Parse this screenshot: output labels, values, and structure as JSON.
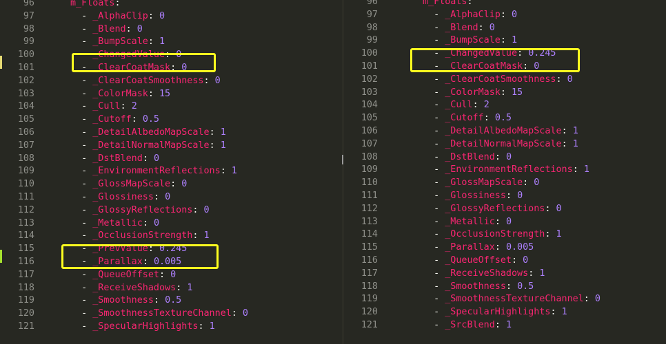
{
  "left": {
    "lines": [
      {
        "num": "96",
        "key": "m_Floats",
        "val": "",
        "indent": "",
        "dash": false
      },
      {
        "num": "97",
        "key": "_AlphaClip",
        "val": "0",
        "dash": true
      },
      {
        "num": "98",
        "key": "_Blend",
        "val": "0",
        "dash": true
      },
      {
        "num": "99",
        "key": "_BumpScale",
        "val": "1",
        "dash": true
      },
      {
        "num": "100",
        "key": "_ChangedValue",
        "val": "0",
        "dash": true
      },
      {
        "num": "101",
        "key": "_ClearCoatMask",
        "val": "0",
        "dash": true
      },
      {
        "num": "102",
        "key": "_ClearCoatSmoothness",
        "val": "0",
        "dash": true
      },
      {
        "num": "103",
        "key": "_ColorMask",
        "val": "15",
        "dash": true
      },
      {
        "num": "104",
        "key": "_Cull",
        "val": "2",
        "dash": true
      },
      {
        "num": "105",
        "key": "_Cutoff",
        "val": "0.5",
        "dash": true
      },
      {
        "num": "106",
        "key": "_DetailAlbedoMapScale",
        "val": "1",
        "dash": true
      },
      {
        "num": "107",
        "key": "_DetailNormalMapScale",
        "val": "1",
        "dash": true
      },
      {
        "num": "108",
        "key": "_DstBlend",
        "val": "0",
        "dash": true
      },
      {
        "num": "109",
        "key": "_EnvironmentReflections",
        "val": "1",
        "dash": true
      },
      {
        "num": "110",
        "key": "_GlossMapScale",
        "val": "0",
        "dash": true
      },
      {
        "num": "111",
        "key": "_Glossiness",
        "val": "0",
        "dash": true
      },
      {
        "num": "112",
        "key": "_GlossyReflections",
        "val": "0",
        "dash": true
      },
      {
        "num": "113",
        "key": "_Metallic",
        "val": "0",
        "dash": true
      },
      {
        "num": "114",
        "key": "_OcclusionStrength",
        "val": "1",
        "dash": true
      },
      {
        "num": "115",
        "key": "_PrevValue",
        "val": "0.245",
        "dash": true
      },
      {
        "num": "116",
        "key": "_Parallax",
        "val": "0.005",
        "dash": true
      },
      {
        "num": "117",
        "key": "_QueueOffset",
        "val": "0",
        "dash": true
      },
      {
        "num": "118",
        "key": "_ReceiveShadows",
        "val": "1",
        "dash": true
      },
      {
        "num": "119",
        "key": "_Smoothness",
        "val": "0.5",
        "dash": true
      },
      {
        "num": "120",
        "key": "_SmoothnessTextureChannel",
        "val": "0",
        "dash": true
      },
      {
        "num": "121",
        "key": "_SpecularHighlights",
        "val": "1",
        "dash": true
      }
    ]
  },
  "right": {
    "lines": [
      {
        "num": "96",
        "key": "m_Floats",
        "val": "",
        "dash": false
      },
      {
        "num": "97",
        "key": "_AlphaClip",
        "val": "0",
        "dash": true
      },
      {
        "num": "98",
        "key": "_Blend",
        "val": "0",
        "dash": true
      },
      {
        "num": "99",
        "key": "_BumpScale",
        "val": "1",
        "dash": true
      },
      {
        "num": "100",
        "key": "_ChangedValue",
        "val": "0.245",
        "dash": true
      },
      {
        "num": "101",
        "key": "_ClearCoatMask",
        "val": "0",
        "dash": true
      },
      {
        "num": "102",
        "key": "_ClearCoatSmoothness",
        "val": "0",
        "dash": true
      },
      {
        "num": "103",
        "key": "_ColorMask",
        "val": "15",
        "dash": true
      },
      {
        "num": "104",
        "key": "_Cull",
        "val": "2",
        "dash": true
      },
      {
        "num": "105",
        "key": "_Cutoff",
        "val": "0.5",
        "dash": true
      },
      {
        "num": "106",
        "key": "_DetailAlbedoMapScale",
        "val": "1",
        "dash": true
      },
      {
        "num": "107",
        "key": "_DetailNormalMapScale",
        "val": "1",
        "dash": true
      },
      {
        "num": "108",
        "key": "_DstBlend",
        "val": "0",
        "dash": true
      },
      {
        "num": "109",
        "key": "_EnvironmentReflections",
        "val": "1",
        "dash": true
      },
      {
        "num": "110",
        "key": "_GlossMapScale",
        "val": "0",
        "dash": true
      },
      {
        "num": "111",
        "key": "_Glossiness",
        "val": "0",
        "dash": true
      },
      {
        "num": "112",
        "key": "_GlossyReflections",
        "val": "0",
        "dash": true
      },
      {
        "num": "113",
        "key": "_Metallic",
        "val": "0",
        "dash": true
      },
      {
        "num": "114",
        "key": "_OcclusionStrength",
        "val": "1",
        "dash": true
      },
      {
        "num": "115",
        "key": "_Parallax",
        "val": "0.005",
        "dash": true
      },
      {
        "num": "116",
        "key": "_QueueOffset",
        "val": "0",
        "dash": true
      },
      {
        "num": "117",
        "key": "_ReceiveShadows",
        "val": "1",
        "dash": true
      },
      {
        "num": "118",
        "key": "_Smoothness",
        "val": "0.5",
        "dash": true
      },
      {
        "num": "119",
        "key": "_SmoothnessTextureChannel",
        "val": "0",
        "dash": true
      },
      {
        "num": "120",
        "key": "_SpecularHighlights",
        "val": "1",
        "dash": true
      },
      {
        "num": "121",
        "key": "_SrcBlend",
        "val": "1",
        "dash": true
      }
    ]
  },
  "colors": {
    "background": "#272822",
    "key": "#f92672",
    "number": "#ae81ff",
    "punctuation": "#f8f8f2",
    "line_number": "#8f908a",
    "highlight_box": "#ffff1f",
    "modified_marker_yellow": "#e6db74",
    "modified_marker_green": "#a6e22e"
  }
}
